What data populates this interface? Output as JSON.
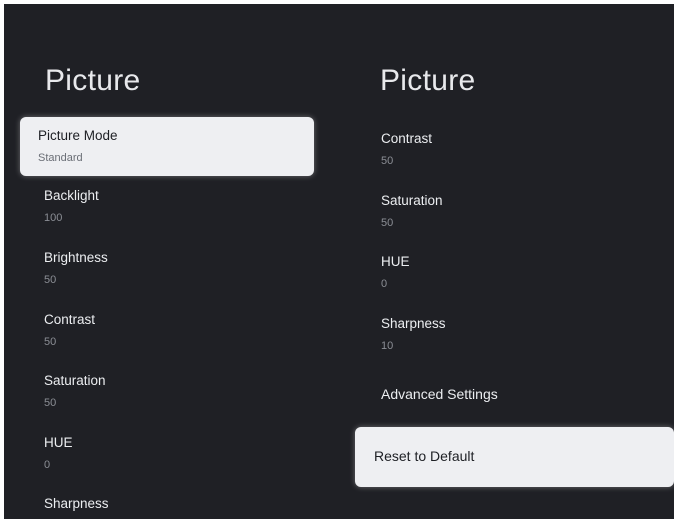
{
  "left_panel": {
    "title": "Picture",
    "items": [
      {
        "label": "Picture Mode",
        "value": "Standard"
      },
      {
        "label": "Backlight",
        "value": "100"
      },
      {
        "label": "Brightness",
        "value": "50"
      },
      {
        "label": "Contrast",
        "value": "50"
      },
      {
        "label": "Saturation",
        "value": "50"
      },
      {
        "label": "HUE",
        "value": "0"
      },
      {
        "label": "Sharpness",
        "value": ""
      }
    ]
  },
  "right_panel": {
    "title": "Picture",
    "items": [
      {
        "label": "Contrast",
        "value": "50"
      },
      {
        "label": "Saturation",
        "value": "50"
      },
      {
        "label": "HUE",
        "value": "0"
      },
      {
        "label": "Sharpness",
        "value": "10"
      },
      {
        "label": "Advanced Settings"
      },
      {
        "label": "Reset to Default"
      }
    ]
  }
}
